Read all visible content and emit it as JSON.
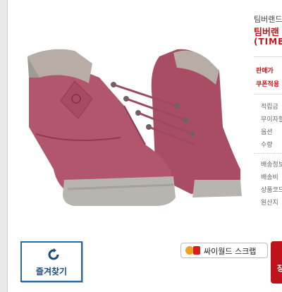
{
  "product": {
    "brand_line": "팀버랜드",
    "title_line": "팀버랜",
    "code_line": "(TIMB",
    "price_label": "판매가",
    "coupon_label": "쿠폰적용",
    "fields": [
      "적립금",
      "무이자할",
      "옵션",
      "수량"
    ],
    "shipping": [
      "배송정보",
      "배송비",
      "상품코드",
      "원산지"
    ]
  },
  "buttons": {
    "favorite_label": "즐겨찾기",
    "scrap_label": "싸이월드 스크랩",
    "buy_label": "장"
  },
  "colors": {
    "boot": "#b2566d",
    "boot_dark": "#8b3c51",
    "collar": "#b7ada4",
    "sole": "#b8b4ae",
    "accent_red": "#c2161b",
    "favorite_border": "#2a6aa0"
  }
}
